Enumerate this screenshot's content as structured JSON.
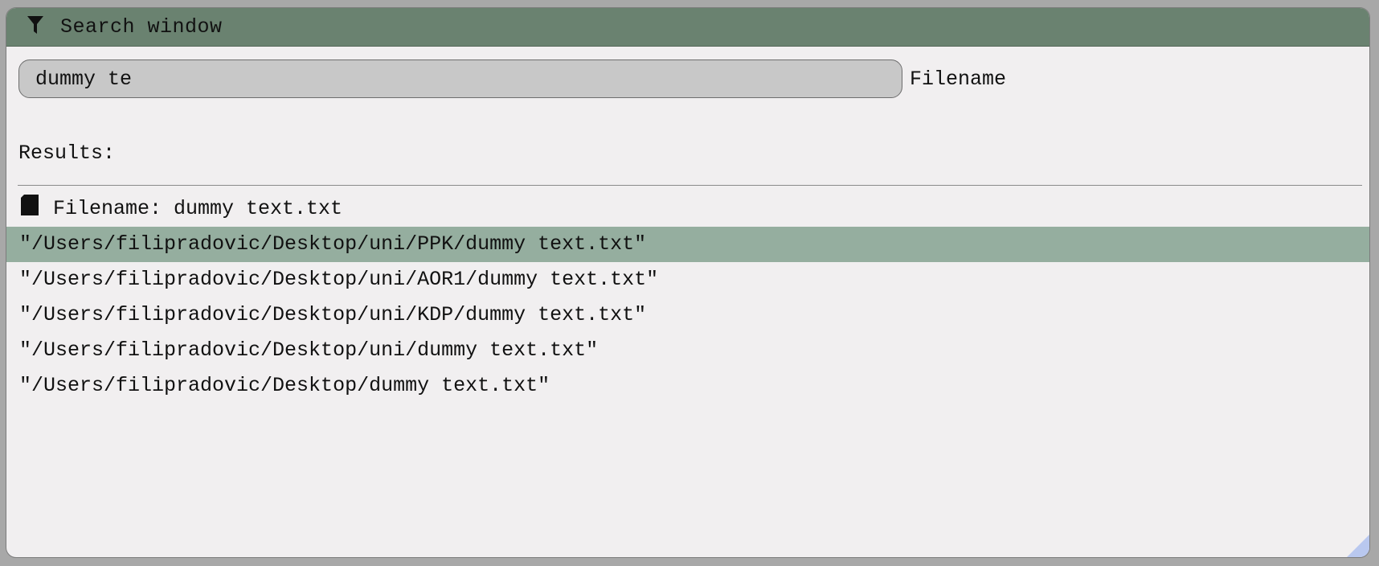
{
  "window": {
    "title": "Search window",
    "title_icon": "filter-icon"
  },
  "search": {
    "value": "dummy te",
    "placeholder": "",
    "mode_label": "Filename"
  },
  "results": {
    "label": "Results:",
    "group_icon": "file-icon",
    "group_header": "Filename: dummy text.txt",
    "selected_index": 0,
    "items": [
      "\"/Users/filipradovic/Desktop/uni/PPK/dummy text.txt\"",
      "\"/Users/filipradovic/Desktop/uni/AOR1/dummy text.txt\"",
      "\"/Users/filipradovic/Desktop/uni/KDP/dummy text.txt\"",
      "\"/Users/filipradovic/Desktop/uni/dummy text.txt\"",
      "\"/Users/filipradovic/Desktop/dummy text.txt\""
    ]
  },
  "colors": {
    "titlebar": "#6a8270",
    "selected_row": "#95ae9f",
    "window_bg": "#f1eff0",
    "input_bg": "#c8c8c8",
    "resize_grip": "#b9c8ef"
  }
}
